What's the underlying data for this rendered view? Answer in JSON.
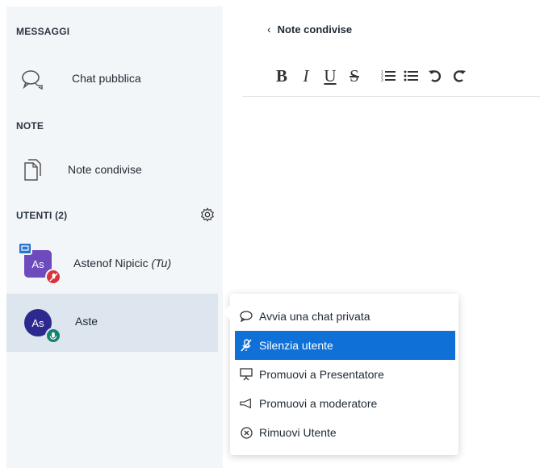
{
  "sidebar": {
    "messages_heading": "MESSAGGI",
    "public_chat_label": "Chat pubblica",
    "notes_heading": "NOTE",
    "shared_notes_label": "Note condivise",
    "users_heading": "UTENTI (2)",
    "users": [
      {
        "initials": "As",
        "name": "Astenof Nipicic",
        "you": "(Tu)",
        "is_presenter": true,
        "muted": true
      },
      {
        "initials": "As",
        "name": "Aste",
        "selected": true,
        "muted": false
      }
    ]
  },
  "main": {
    "back_title": "Note condivise",
    "toolbar": [
      "B",
      "I",
      "U",
      "S",
      "ordered-list",
      "bullet-list",
      "undo",
      "redo"
    ]
  },
  "context_menu": {
    "items": [
      {
        "label": "Avvia una chat privata",
        "icon": "chat-icon",
        "active": false
      },
      {
        "label": "Silenzia utente",
        "icon": "mute-icon",
        "active": true
      },
      {
        "label": "Promuovi a Presentatore",
        "icon": "presentation-icon",
        "active": false
      },
      {
        "label": "Promuovi a moderatore",
        "icon": "megaphone-icon",
        "active": false
      },
      {
        "label": "Rimuovi Utente",
        "icon": "remove-circle-icon",
        "active": false
      }
    ]
  },
  "colors": {
    "accent": "#0f70d7",
    "muted_badge": "#d8343f",
    "unmuted_badge": "#15836e",
    "presenter_badge": "#2b75d2"
  }
}
